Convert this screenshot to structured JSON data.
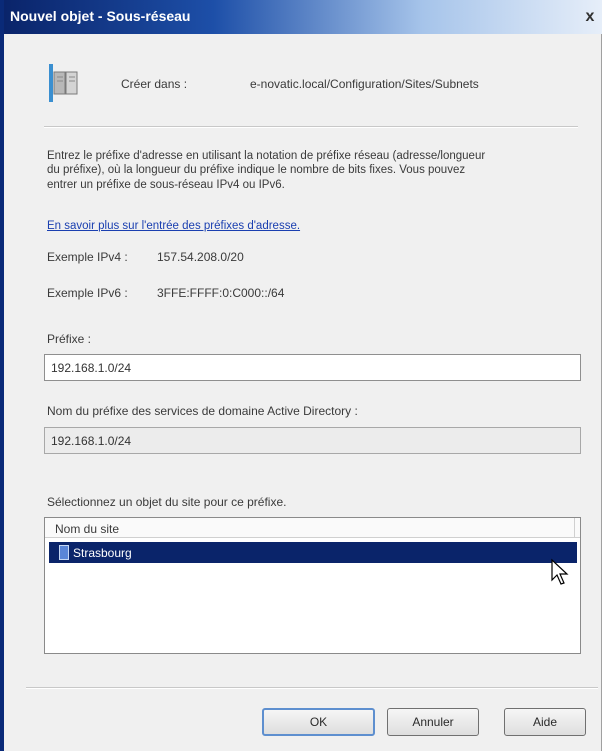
{
  "window": {
    "title": "Nouvel objet - Sous-réseau",
    "close_glyph": "x"
  },
  "header": {
    "icon": "book-icon",
    "create_in_label": "Créer dans :",
    "create_in_path": "e-novatic.local/Configuration/Sites/Subnets"
  },
  "description": {
    "text": "Entrez le préfixe d'adresse en utilisant la notation de préfixe réseau (adresse/longueur du préfixe), où la longueur du préfixe indique le nombre de bits fixes. Vous pouvez entrer un préfixe de sous-réseau IPv4 ou IPv6.",
    "link": "En savoir plus sur l'entrée des préfixes d'adresse."
  },
  "examples": {
    "ipv4_label": "Exemple IPv4 :",
    "ipv4_value": "157.54.208.0/20",
    "ipv6_label": "Exemple IPv6 :",
    "ipv6_value": "3FFE:FFFF:0:C000::/64"
  },
  "prefix": {
    "label": "Préfixe :",
    "value": "192.168.1.0/24"
  },
  "ad_prefix": {
    "label": "Nom du préfixe des services de domaine Active Directory :",
    "value": "192.168.1.0/24"
  },
  "site_select": {
    "label": "Sélectionnez un objet du site pour ce préfixe.",
    "column_header": "Nom du site",
    "items": [
      {
        "name": "Strasbourg",
        "selected": true,
        "icon": "site-icon"
      }
    ]
  },
  "buttons": {
    "ok": "OK",
    "cancel": "Annuler",
    "help": "Aide"
  },
  "colors": {
    "selection": "#0a246a",
    "link": "#1a3fb0",
    "titlebar_start": "#0a246a"
  }
}
